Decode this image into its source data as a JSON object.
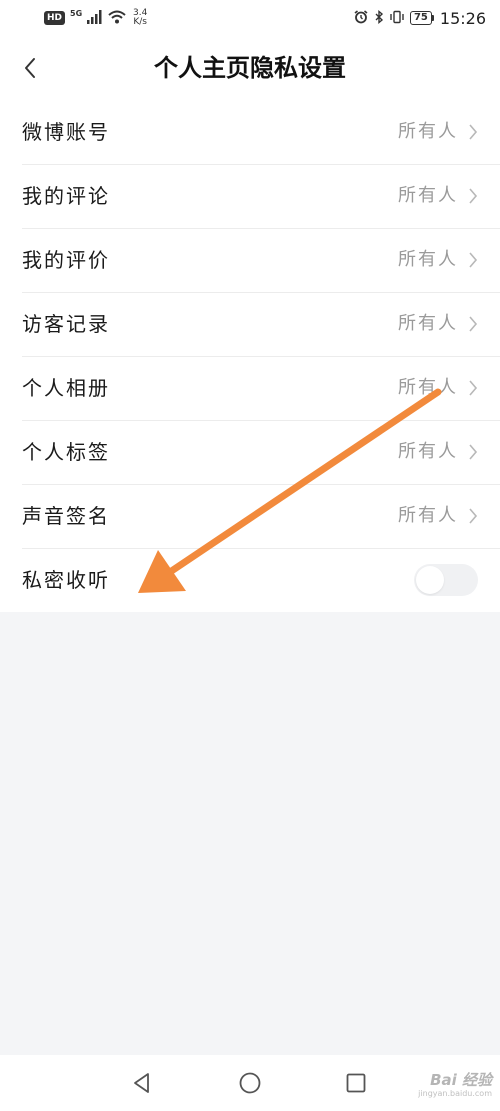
{
  "status_bar": {
    "hd_badge": "HD",
    "network_type": "5G",
    "speed_value": "3.4",
    "speed_unit": "K/s",
    "battery_level": "75",
    "time": "15:26",
    "icons": [
      "signal-icon",
      "wifi-icon",
      "alarm-icon",
      "bluetooth-icon",
      "vibrate-icon",
      "battery-icon"
    ]
  },
  "header": {
    "title": "个人主页隐私设置",
    "back_icon": "chevron-left-icon"
  },
  "settings": {
    "items": [
      {
        "label": "微博账号",
        "value": "所有人"
      },
      {
        "label": "我的评论",
        "value": "所有人"
      },
      {
        "label": "我的评价",
        "value": "所有人"
      },
      {
        "label": "访客记录",
        "value": "所有人"
      },
      {
        "label": "个人相册",
        "value": "所有人"
      },
      {
        "label": "个人标签",
        "value": "所有人"
      },
      {
        "label": "声音签名",
        "value": "所有人"
      }
    ],
    "toggle_item": {
      "label": "私密收听",
      "enabled": false
    }
  },
  "annotation": {
    "type": "arrow",
    "color": "#f28a3c"
  },
  "nav_bar": {
    "icons": [
      "back-triangle-icon",
      "home-circle-icon",
      "recents-square-icon"
    ],
    "watermark": "Bai 经验",
    "watermark_sub": "jingyan.baidu.com"
  },
  "colors": {
    "background": "#f4f5f7",
    "surface": "#ffffff",
    "text_primary": "#1a1a1a",
    "text_secondary": "#9a9a9a",
    "divider": "#ececec",
    "annotation_arrow": "#f28a3c"
  }
}
